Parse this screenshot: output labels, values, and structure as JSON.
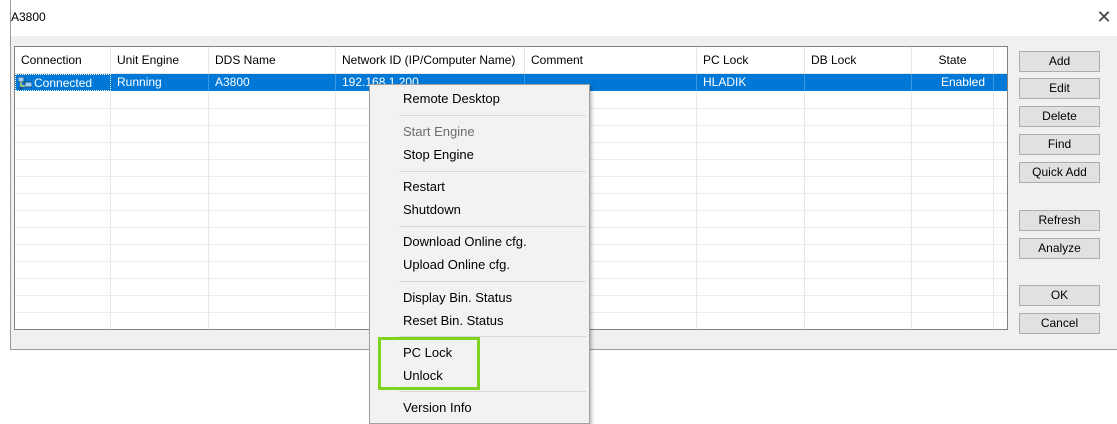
{
  "window": {
    "title": "A3800",
    "close_label": "✕"
  },
  "grid": {
    "columns": [
      {
        "label": "Connection"
      },
      {
        "label": "Unit Engine"
      },
      {
        "label": "DDS Name"
      },
      {
        "label": "Network ID (IP/Computer Name)"
      },
      {
        "label": "Comment"
      },
      {
        "label": "PC Lock"
      },
      {
        "label": "DB Lock"
      },
      {
        "label": "State"
      }
    ],
    "rows": [
      {
        "connection": "Connected",
        "unit_engine": "Running",
        "dds_name": "A3800",
        "network_id": "192.168.1.200",
        "comment": "",
        "pc_lock": "HLADIK",
        "db_lock": "",
        "state": "Enabled",
        "selected": true,
        "icon": "network-computer-icon"
      }
    ]
  },
  "buttons": {
    "add": "Add",
    "edit": "Edit",
    "delete": "Delete",
    "find": "Find",
    "quick_add": "Quick Add",
    "refresh": "Refresh",
    "analyze": "Analyze",
    "ok": "OK",
    "cancel": "Cancel"
  },
  "context_menu": {
    "remote_desktop": "Remote Desktop",
    "start_engine": "Start Engine",
    "stop_engine": "Stop Engine",
    "restart": "Restart",
    "shutdown": "Shutdown",
    "download_online_cfg": "Download Online cfg.",
    "upload_online_cfg": "Upload Online cfg.",
    "display_bin_status": "Display Bin. Status",
    "reset_bin_status": "Reset Bin. Status",
    "pc_lock": "PC Lock",
    "unlock": "Unlock",
    "version_info": "Version Info"
  },
  "colors": {
    "selection": "#0078d7",
    "highlight": "#7ed321"
  }
}
